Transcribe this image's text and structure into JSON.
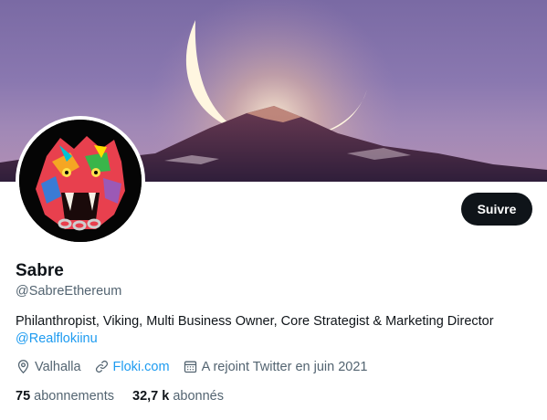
{
  "profile": {
    "name": "Sabre",
    "handle": "@SabreEthereum",
    "bio_text": "Philanthropist, Viking, Multi Business Owner, Core Strategist & Marketing Director",
    "bio_mention": "@Realflokiinu"
  },
  "actions": {
    "follow_label": "Suivre"
  },
  "meta": {
    "location": "Valhalla",
    "website": "Floki.com",
    "joined": "A rejoint Twitter en juin 2021"
  },
  "stats": {
    "following_count": "75",
    "following_label": "abonnements",
    "followers_count": "32,7 k",
    "followers_label": "abonnés"
  },
  "icons": {
    "location": "location-pin-icon",
    "link": "link-icon",
    "calendar": "calendar-icon"
  },
  "colors": {
    "link_blue": "#1d9bf0",
    "text_primary": "#0f1419",
    "text_secondary": "#536471",
    "button_bg": "#0f1419"
  }
}
